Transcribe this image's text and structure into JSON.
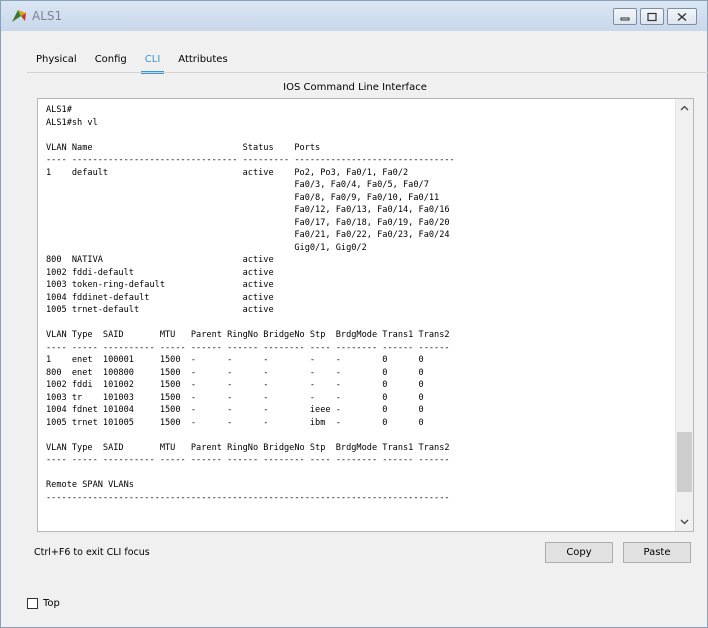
{
  "window": {
    "title": "ALS1"
  },
  "tabs": [
    {
      "label": "Physical"
    },
    {
      "label": "Config"
    },
    {
      "label": "CLI"
    },
    {
      "label": "Attributes"
    }
  ],
  "active_tab": "CLI",
  "cli": {
    "header": "IOS Command Line Interface",
    "lines": [
      "ALS1#",
      "ALS1#sh vl",
      "",
      "VLAN Name                             Status    Ports",
      "---- -------------------------------- --------- -------------------------------",
      "1    default                          active    Po2, Po3, Fa0/1, Fa0/2",
      "                                                Fa0/3, Fa0/4, Fa0/5, Fa0/7",
      "                                                Fa0/8, Fa0/9, Fa0/10, Fa0/11",
      "                                                Fa0/12, Fa0/13, Fa0/14, Fa0/16",
      "                                                Fa0/17, Fa0/18, Fa0/19, Fa0/20",
      "                                                Fa0/21, Fa0/22, Fa0/23, Fa0/24",
      "                                                Gig0/1, Gig0/2",
      "800  NATIVA                           active",
      "1002 fddi-default                     active",
      "1003 token-ring-default               active",
      "1004 fddinet-default                  active",
      "1005 trnet-default                    active",
      "",
      "VLAN Type  SAID       MTU   Parent RingNo BridgeNo Stp  BrdgMode Trans1 Trans2",
      "---- ----- ---------- ----- ------ ------ -------- ---- -------- ------ ------",
      "1    enet  100001     1500  -      -      -        -    -        0      0",
      "800  enet  100800     1500  -      -      -        -    -        0      0",
      "1002 fddi  101002     1500  -      -      -        -    -        0      0",
      "1003 tr    101003     1500  -      -      -        -    -        0      0",
      "1004 fdnet 101004     1500  -      -      -        ieee -        0      0",
      "1005 trnet 101005     1500  -      -      -        ibm  -        0      0",
      "",
      "VLAN Type  SAID       MTU   Parent RingNo BridgeNo Stp  BrdgMode Trans1 Trans2",
      "---- ----- ---------- ----- ------ ------ -------- ---- -------- ------ ------",
      "",
      "Remote SPAN VLANs",
      "------------------------------------------------------------------------------"
    ]
  },
  "footer": {
    "hint": "Ctrl+F6 to exit CLI focus",
    "copy_label": "Copy",
    "paste_label": "Paste"
  },
  "top_checkbox": {
    "label": "Top",
    "checked": false
  },
  "colors": {
    "accent": "#3a96d8",
    "titlebar": "#dbe6f3"
  }
}
